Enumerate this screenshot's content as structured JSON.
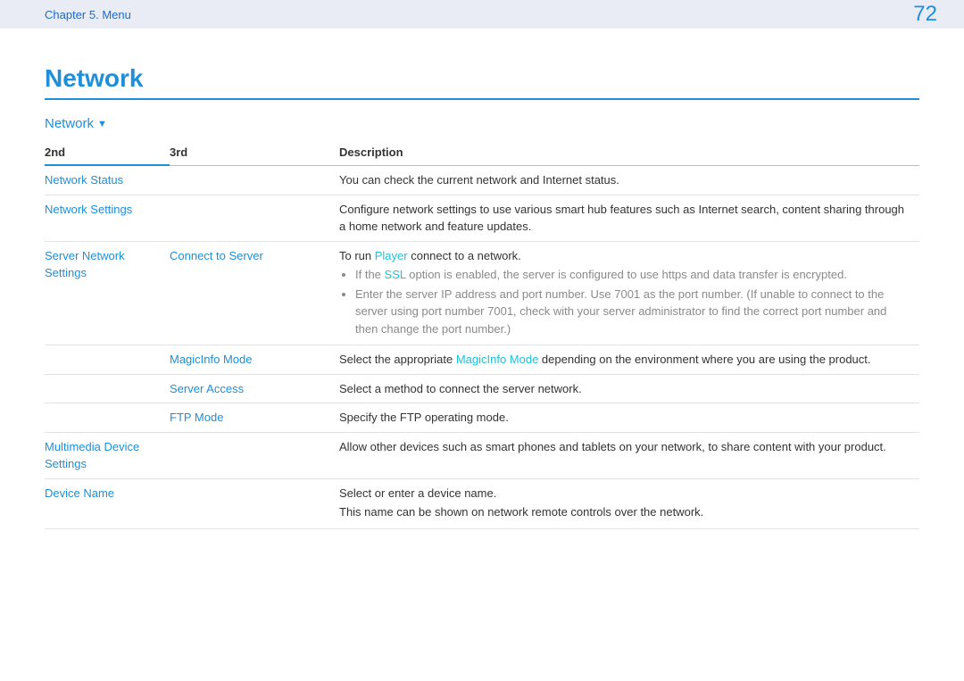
{
  "header": {
    "breadcrumb": "Chapter 5. Menu",
    "page_number": "72"
  },
  "title": "Network",
  "section": {
    "label": "Network"
  },
  "columns": {
    "c2nd": "2nd",
    "c3rd": "3rd",
    "cdesc": "Description"
  },
  "rows": {
    "network_status": {
      "second": "Network Status",
      "desc": "You can check the current network and Internet status."
    },
    "network_settings": {
      "second": "Network Settings",
      "desc": "Configure network settings to use various smart hub features such as Internet search, content sharing through a home network and feature updates."
    },
    "server_network": {
      "second": "Server Network Settings",
      "connect": {
        "third": "Connect to Server",
        "line1_a": "To run ",
        "line1_b": "Player",
        "line1_c": " connect to a network.",
        "bullet1_a": "If the ",
        "bullet1_b": "SSL",
        "bullet1_c": " option is enabled, the server is configured to use https and data transfer is encrypted.",
        "bullet2": "Enter the server IP address and port number. Use 7001 as the port number. (If unable to connect to the server using port number 7001, check with your server administrator to find the correct port number and then change the port number.)"
      },
      "magicinfo": {
        "third": "MagicInfo Mode",
        "a": "Select the appropriate ",
        "b": "MagicInfo Mode",
        "c": " depending on the environment where you are using the product."
      },
      "server_access": {
        "third": "Server Access",
        "desc": "Select a method to connect the server network."
      },
      "ftp_mode": {
        "third": "FTP Mode",
        "desc": "Specify the FTP operating mode."
      }
    },
    "multimedia": {
      "second": "Multimedia Device Settings",
      "desc": "Allow other devices such as smart phones and tablets on your network, to share content with your product."
    },
    "device_name": {
      "second": "Device Name",
      "line1": "Select or enter a device name.",
      "line2": "This name can be shown on network remote controls over the network."
    }
  }
}
